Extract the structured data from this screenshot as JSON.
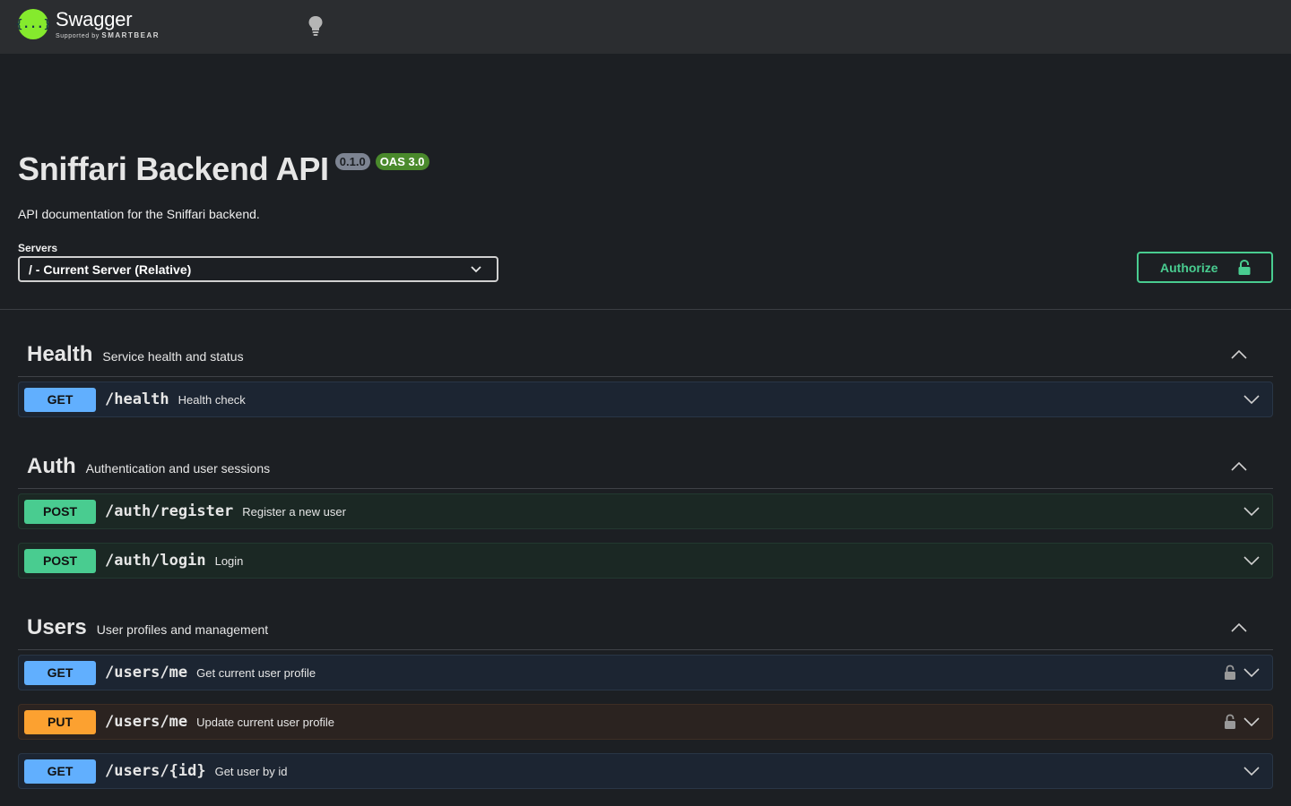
{
  "header": {
    "logo_text": "Swagger",
    "logo_sub_small": "Supported by",
    "logo_sub_brand": "SMARTBEAR",
    "logo_glyph": "{...}",
    "theme_icon": "lightbulb-icon"
  },
  "info": {
    "title": "Sniffari Backend API",
    "version": "0.1.0",
    "oas": "OAS 3.0",
    "description": "API documentation for the Sniffari backend."
  },
  "servers": {
    "label": "Servers",
    "selected": "/ - Current Server (Relative)"
  },
  "authorize": {
    "label": "Authorize",
    "icon": "unlocked-icon"
  },
  "colors": {
    "get": "#61affe",
    "post": "#49cc90",
    "put": "#fca130",
    "accent": "#49cc90"
  },
  "tags": [
    {
      "name": "Health",
      "description": "Service health and status",
      "operations": [
        {
          "method": "GET",
          "path": "/health",
          "summary": "Health check",
          "locked": false
        }
      ]
    },
    {
      "name": "Auth",
      "description": "Authentication and user sessions",
      "operations": [
        {
          "method": "POST",
          "path": "/auth/register",
          "summary": "Register a new user",
          "locked": false
        },
        {
          "method": "POST",
          "path": "/auth/login",
          "summary": "Login",
          "locked": false
        }
      ]
    },
    {
      "name": "Users",
      "description": "User profiles and management",
      "operations": [
        {
          "method": "GET",
          "path": "/users/me",
          "summary": "Get current user profile",
          "locked": true
        },
        {
          "method": "PUT",
          "path": "/users/me",
          "summary": "Update current user profile",
          "locked": true
        },
        {
          "method": "GET",
          "path": "/users/{id}",
          "summary": "Get user by id",
          "locked": false
        }
      ]
    }
  ]
}
